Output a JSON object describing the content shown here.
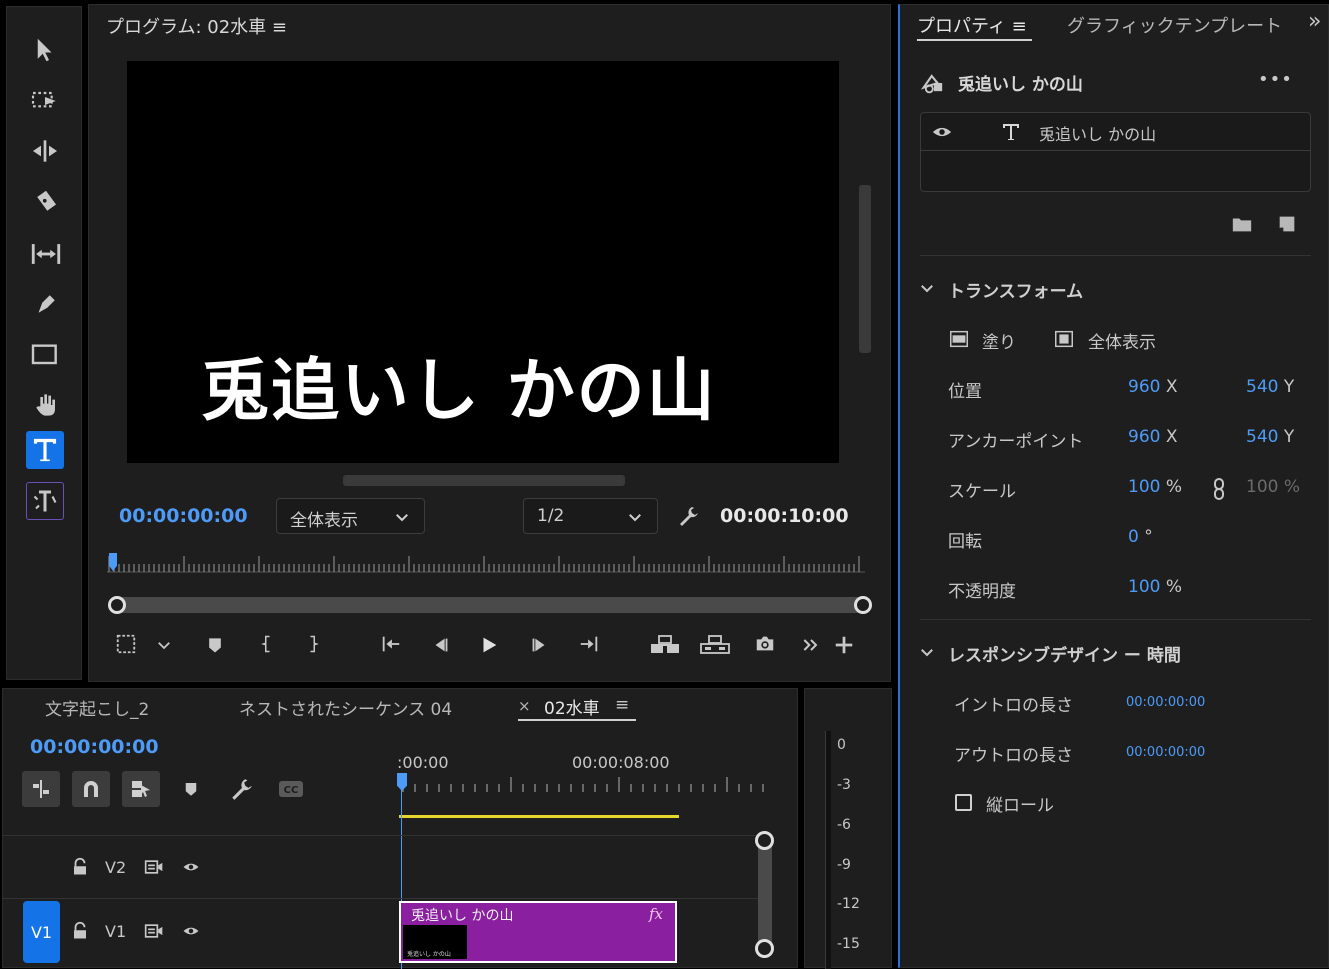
{
  "toolbar": {
    "tools": [
      "select-icon",
      "track-select-icon",
      "ripple-edit-icon",
      "razor-icon",
      "slip-icon",
      "pen-icon",
      "rectangle-icon",
      "hand-icon",
      "type-icon",
      "vertical-type-icon"
    ],
    "active": "type-icon"
  },
  "program": {
    "title": "プログラム: 02水車 ≡",
    "overlay_text": "兎追いし かの山",
    "timecode_left": "00:00:00:00",
    "fit_select": "全体表示",
    "res_select": "1/2",
    "timecode_right": "00:00:10:00",
    "playhead": 0,
    "transport_icons": [
      "marker-in-out-icon",
      "chevron-down-icon",
      "add-marker-icon",
      "mark-in-icon",
      "mark-out-icon",
      "go-to-in-icon",
      "step-back-icon",
      "play-icon",
      "step-forward-icon",
      "go-to-out-icon",
      "lift-icon",
      "extract-icon",
      "export-frame-icon",
      "more-icon",
      "plus-icon"
    ]
  },
  "properties": {
    "tab_active": "プロパティ ≡",
    "tab_other": "グラフィックテンプレート",
    "more": "»",
    "clip_name": "兎追いし かの山",
    "menu": "•••",
    "layer_name": "兎追いし かの山",
    "transform": {
      "title": "トランスフォーム",
      "fill_label": "塗り",
      "fit_label": "全体表示",
      "rows": [
        {
          "label": "位置",
          "v1": "960",
          "u1": "X",
          "v2": "540",
          "u2": "Y"
        },
        {
          "label": "アンカーポイント",
          "v1": "960",
          "u1": "X",
          "v2": "540",
          "u2": "Y"
        },
        {
          "label": "スケール",
          "v1": "100",
          "u1": "%",
          "v2": "100",
          "u2": "%"
        },
        {
          "label": "回転",
          "v1": "0",
          "u1": "°"
        },
        {
          "label": "不透明度",
          "v1": "100",
          "u1": "%"
        }
      ]
    },
    "responsive": {
      "title": "レスポンシブデザイン ー 時間",
      "intro_label": "イントロの長さ",
      "intro_value": "00:00:00:00",
      "outro_label": "アウトロの長さ",
      "outro_value": "00:00:00:00",
      "roll_label": "縦ロール"
    }
  },
  "timeline": {
    "tabs": [
      "文字起こし_2",
      "ネストされたシーケンス 04",
      "02水車"
    ],
    "tab_close": "×",
    "tab_menu": "≡",
    "timecode": "00:00:00:00",
    "ruler": [
      ":00:00",
      "00:00:08:00"
    ],
    "tracks": [
      {
        "name": "V2"
      },
      {
        "name": "V1",
        "active": "V1"
      }
    ],
    "clip": {
      "name": "兎追いし かの山",
      "fx": "fx",
      "thumb_text": "兎追いし かの山",
      "color": "#8a1fa0"
    }
  },
  "meter": {
    "ticks": [
      "0",
      "-3",
      "-6",
      "-9",
      "-12",
      "-15"
    ]
  }
}
